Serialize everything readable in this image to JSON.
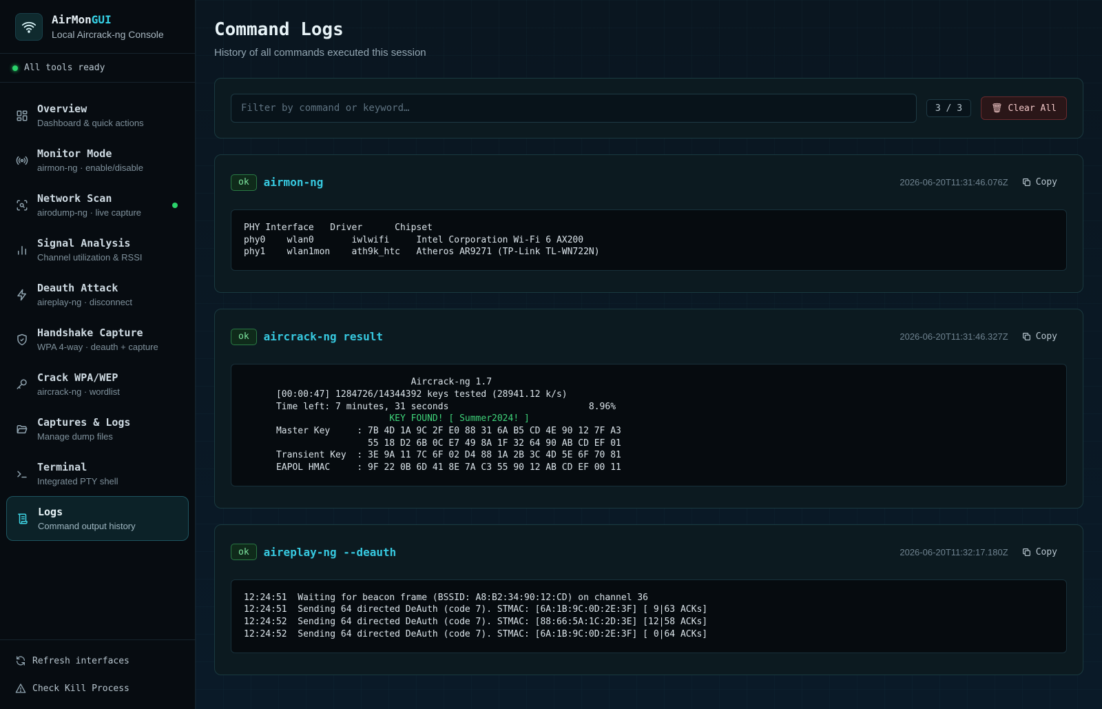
{
  "brand": {
    "name_main": "AirMon",
    "name_accent": "GUI",
    "subtitle": "Local Aircrack-ng Console"
  },
  "status": {
    "text": "All tools ready",
    "color": "#2bd36b"
  },
  "nav": [
    {
      "label": "Overview",
      "sub": "Dashboard & quick actions",
      "icon": "grid-icon"
    },
    {
      "label": "Monitor Mode",
      "sub": "airmon-ng · enable/disable",
      "icon": "broadcast-icon"
    },
    {
      "label": "Network Scan",
      "sub": "airodump-ng · live capture",
      "icon": "scan-icon"
    },
    {
      "label": "Signal Analysis",
      "sub": "Channel utilization & RSSI",
      "icon": "bar-chart-icon"
    },
    {
      "label": "Deauth Attack",
      "sub": "aireplay-ng · disconnect",
      "icon": "bolt-icon"
    },
    {
      "label": "Handshake Capture",
      "sub": "WPA 4-way · deauth + capture",
      "icon": "shield-check-icon"
    },
    {
      "label": "Crack WPA/WEP",
      "sub": "aircrack-ng · wordlist",
      "icon": "key-icon"
    },
    {
      "label": "Captures & Logs",
      "sub": "Manage dump files",
      "icon": "folder-open-icon"
    },
    {
      "label": "Terminal",
      "sub": "Integrated PTY shell",
      "icon": "terminal-icon"
    },
    {
      "label": "Logs",
      "sub": "Command output history",
      "icon": "scroll-icon"
    }
  ],
  "footer": {
    "refresh": "Refresh interfaces",
    "check_kill": "Check Kill Process"
  },
  "page": {
    "title": "Command Logs",
    "subtitle": "History of all commands executed this session"
  },
  "filter": {
    "placeholder": "Filter by command or keyword…",
    "count": "3 / 3",
    "clear_label": "Clear All"
  },
  "copy_label": "Copy",
  "logs": [
    {
      "status": "ok",
      "name": "airmon-ng",
      "time": "2026-06-20T11:31:46.076Z",
      "lines": [
        "PHY Interface   Driver      Chipset",
        "phy0    wlan0       iwlwifi     Intel Corporation Wi-Fi 6 AX200",
        "phy1    wlan1mon    ath9k_htc   Atheros AR9271 (TP-Link TL-WN722N)"
      ]
    },
    {
      "status": "ok",
      "name": "aircrack-ng result",
      "time": "2026-06-20T11:31:46.327Z",
      "lines": [
        "                               Aircrack-ng 1.7",
        "      [00:00:47] 1284726/14344392 keys tested (28941.12 k/s)",
        "      Time left: 7 minutes, 31 seconds                          8.96%",
        "                           KEY FOUND! [ Summer2024! ]",
        "      Master Key     : 7B 4D 1A 9C 2F E0 88 31 6A B5 CD 4E 90 12 7F A3",
        "                       55 18 D2 6B 0C E7 49 8A 1F 32 64 90 AB CD EF 01",
        "      Transient Key  : 3E 9A 11 7C 6F 02 D4 88 1A 2B 3C 4D 5E 6F 70 81",
        "      EAPOL HMAC     : 9F 22 0B 6D 41 8E 7A C3 55 90 12 AB CD EF 00 11"
      ],
      "highlight_line": 3
    },
    {
      "status": "ok",
      "name": "aireplay-ng --deauth",
      "time": "2026-06-20T11:32:17.180Z",
      "lines": [
        "12:24:51  Waiting for beacon frame (BSSID: A8:B2:34:90:12:CD) on channel 36",
        "12:24:51  Sending 64 directed DeAuth (code 7). STMAC: [6A:1B:9C:0D:2E:3F] [ 9|63 ACKs]",
        "12:24:52  Sending 64 directed DeAuth (code 7). STMAC: [88:66:5A:1C:2D:3E] [12|58 ACKs]",
        "12:24:52  Sending 64 directed DeAuth (code 7). STMAC: [6A:1B:9C:0D:2E:3F] [ 0|64 ACKs]"
      ]
    }
  ]
}
